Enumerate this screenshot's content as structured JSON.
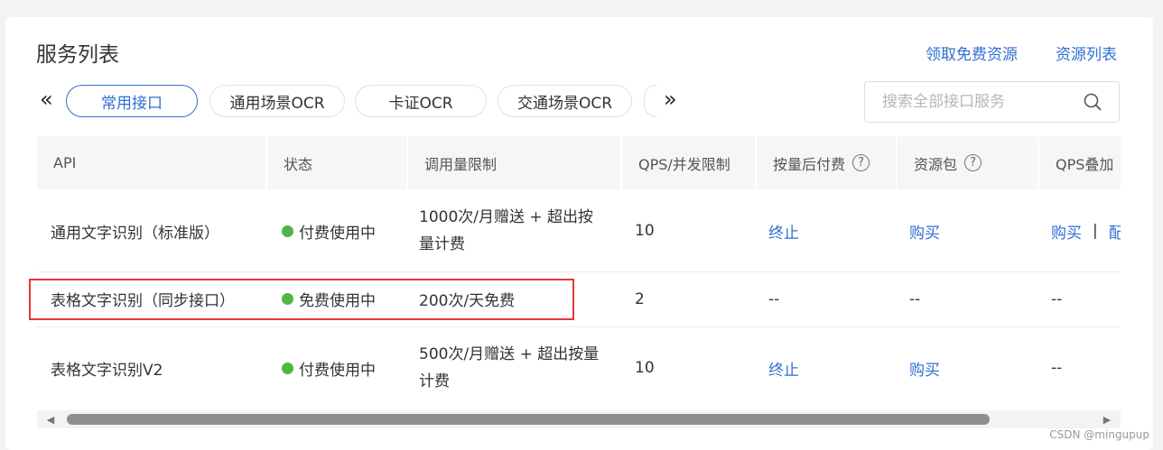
{
  "header": {
    "title": "服务列表",
    "link_free": "领取免费资源",
    "link_list": "资源列表"
  },
  "tabs": {
    "prev": "«",
    "next": "»",
    "items": [
      "常用接口",
      "通用场景OCR",
      "卡证OCR",
      "交通场景OCR"
    ]
  },
  "search": {
    "placeholder": "搜索全部接口服务"
  },
  "table": {
    "headers": [
      "API",
      "状态",
      "调用量限制",
      "QPS/并发限制",
      "按量后付费",
      "资源包",
      "QPS叠加"
    ],
    "rows": [
      {
        "api": "通用文字识别（标准版）",
        "status": "付费使用中",
        "limit": "1000次/月赠送 + 超出按量计费",
        "qps": "10",
        "payg": "终止",
        "pack": "购买",
        "qps_add": "购买",
        "qps_add2": "配"
      },
      {
        "api": "表格文字识别（同步接口）",
        "status": "免费使用中",
        "limit": "200次/天免费",
        "qps": "2",
        "payg": "--",
        "pack": "--",
        "qps_add": "--"
      },
      {
        "api": "表格文字识别V2",
        "status": "付费使用中",
        "limit": "500次/月赠送 + 超出按量计费",
        "qps": "10",
        "payg": "终止",
        "pack": "购买",
        "qps_add": "--"
      }
    ],
    "pipe": "|"
  },
  "watermark": "CSDN @mingupup",
  "colors": {
    "link": "#2f6fd1",
    "status_dot": "#52b446",
    "highlight": "#e53935"
  }
}
